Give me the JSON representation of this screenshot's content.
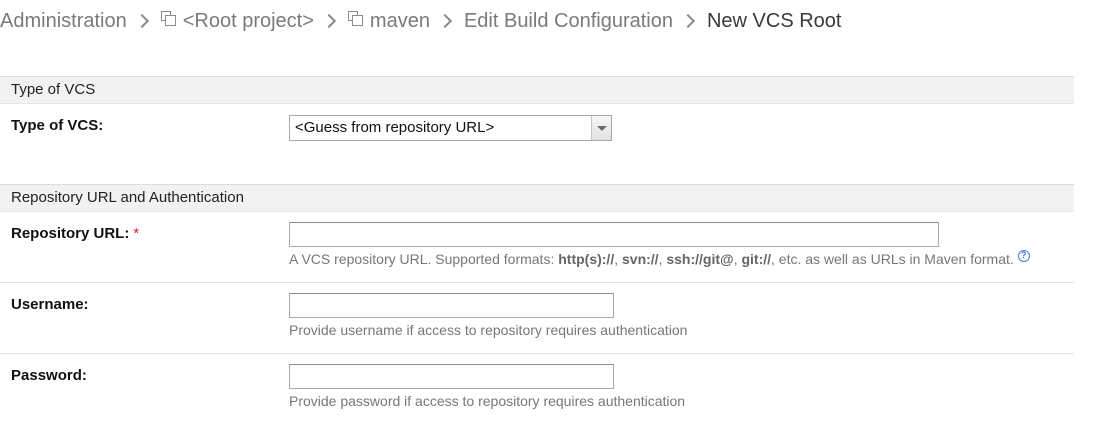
{
  "breadcrumb": {
    "items": [
      {
        "label": "Administration"
      },
      {
        "label": "<Root project>",
        "icon": "project-icon"
      },
      {
        "label": "maven",
        "icon": "project-icon"
      },
      {
        "label": "Edit Build Configuration"
      },
      {
        "label": "New VCS Root"
      }
    ]
  },
  "sections": {
    "type_of_vcs": {
      "title": "Type of VCS",
      "field_label": "Type of VCS:",
      "selected_value": "<Guess from repository URL>"
    },
    "repository": {
      "title": "Repository URL and Authentication",
      "url": {
        "label": "Repository URL:",
        "required_mark": "*",
        "value": "",
        "hint_prefix": "A VCS repository URL. Supported formats: ",
        "hint_formats": [
          "http(s)://",
          "svn://",
          "ssh://git@",
          "git://"
        ],
        "hint_suffix": ", etc. as well as URLs in Maven format.",
        "help_glyph": "?"
      },
      "username": {
        "label": "Username:",
        "value": "",
        "hint": "Provide username if access to repository requires authentication"
      },
      "password": {
        "label": "Password:",
        "value": "",
        "hint": "Provide password if access to repository requires authentication"
      }
    }
  },
  "colors": {
    "required": "#d62b2b",
    "help_icon": "#3b7dd8",
    "section_bg": "#f2f2f2"
  }
}
